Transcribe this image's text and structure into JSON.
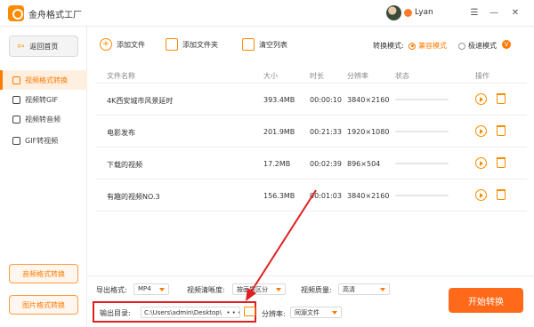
{
  "app": {
    "title": "金舟格式工厂",
    "user_name": "Lyan"
  },
  "window_controls": {
    "menu_label": "☰",
    "minimize_label": "—",
    "close_label": "✕"
  },
  "sidebar": {
    "home_label": "返回首页",
    "items": [
      {
        "label": "视频格式转换",
        "active": true
      },
      {
        "label": "视频转GIF",
        "active": false
      },
      {
        "label": "视频转音频",
        "active": false
      },
      {
        "label": "GIF转视频",
        "active": false
      }
    ],
    "audio_convert_label": "音频格式转换",
    "image_convert_label": "图片格式转换"
  },
  "toolbar": {
    "add_file_label": "添加文件",
    "add_folder_label": "添加文件夹",
    "clear_list_label": "清空列表",
    "mode_label": "转换模式:",
    "mode_options": [
      {
        "label": "兼容模式",
        "selected": true
      },
      {
        "label": "极速模式",
        "selected": false
      }
    ],
    "vip_badge": "V"
  },
  "table": {
    "headers": {
      "name": "文件名称",
      "size": "大小",
      "duration": "时长",
      "resolution": "分辨率",
      "status": "状态",
      "action": "操作"
    },
    "rows": [
      {
        "name": "4K西安城市风景延时",
        "size": "393.4MB",
        "duration": "00:00:10",
        "resolution": "3840×2160",
        "progress": 0
      },
      {
        "name": "电影发布",
        "size": "201.9MB",
        "duration": "00:21:33",
        "resolution": "1920×1080",
        "progress": 0
      },
      {
        "name": "下载的视频",
        "size": "17.2MB",
        "duration": "00:02:39",
        "resolution": "896×504",
        "progress": 0
      },
      {
        "name": "有趣的视频NO.3",
        "size": "156.3MB",
        "duration": "00:01:03",
        "resolution": "3840×2160",
        "progress": 0
      }
    ]
  },
  "settings": {
    "export_format_label": "导出格式:",
    "export_format_value": "MP4",
    "clarity_label": "视频清晰度:",
    "clarity_value": "按画质区分",
    "quality_label": "视频质量:",
    "quality_value": "高清",
    "output_dir_label": "输出目录:",
    "output_dir_value": "C:\\Users\\admin\\Desktop\\",
    "output_dir_more": "• • •",
    "resolution_label": "分辨率:",
    "resolution_value": "同源文件",
    "start_label": "开始转换"
  },
  "colors": {
    "accent": "#ff7a00",
    "annotation": "#e02020"
  }
}
